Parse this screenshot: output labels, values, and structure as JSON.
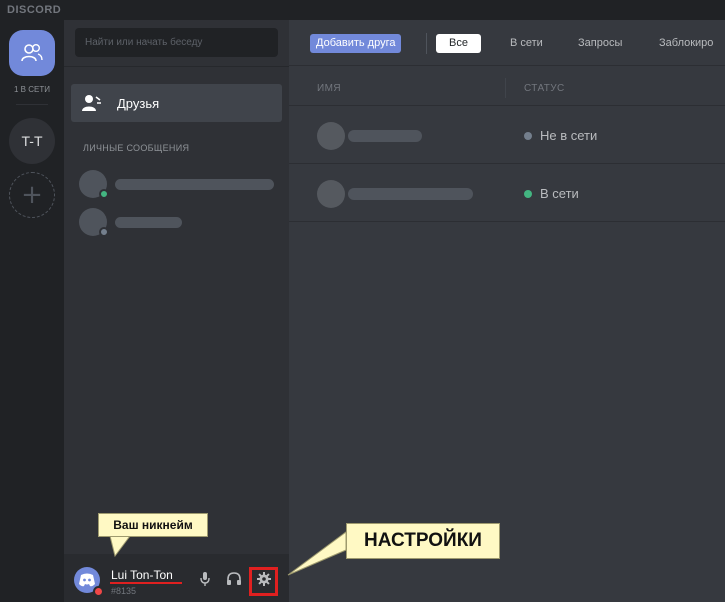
{
  "app": {
    "brand": "DISCORD"
  },
  "rail": {
    "online_count": "1 В СЕТИ",
    "guild_label": "T-T",
    "add_label": "+"
  },
  "channels": {
    "search_placeholder": "Найти или начать беседу",
    "friends_label": "Друзья",
    "dm_header": "ЛИЧНЫЕ СООБЩЕНИЯ",
    "dms": [
      {
        "status_color": "#43b581"
      },
      {
        "status_color": "#747f8d"
      }
    ]
  },
  "user": {
    "name": "Lui Ton-Ton",
    "tag": "#8135",
    "status_color": "#f04747"
  },
  "topbar": {
    "add_friend_label": "Добавить друга",
    "tabs": [
      "Все",
      "В сети",
      "Запросы",
      "Заблокиро"
    ],
    "active_tab": "Все"
  },
  "friends_list": {
    "col_name": "ИМЯ",
    "col_status": "СТАТУС",
    "rows": [
      {
        "status": "Не в сети",
        "status_color": "#747f8d"
      },
      {
        "status": "В сети",
        "status_color": "#43b581"
      }
    ]
  },
  "annotations": {
    "nickname_callout": "Ваш никнейм",
    "settings_callout": "НАСТРОЙКИ"
  },
  "colors": {
    "accent": "#7289da",
    "highlight_red": "#e02020",
    "callout_bg": "#fff9c4"
  }
}
